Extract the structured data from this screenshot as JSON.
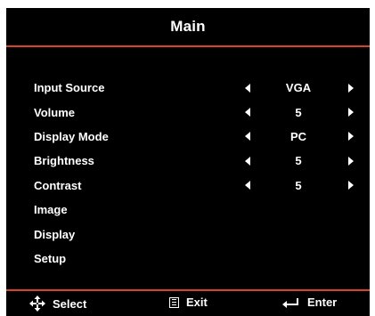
{
  "osd": {
    "title": "Main",
    "accent_color": "#d8432a",
    "background_color": "#000000",
    "items": [
      {
        "label": "Input Source",
        "value": "VGA",
        "adjustable": true
      },
      {
        "label": "Volume",
        "value": "5",
        "adjustable": true
      },
      {
        "label": "Display Mode",
        "value": "PC",
        "adjustable": true
      },
      {
        "label": "Brightness",
        "value": "5",
        "adjustable": true
      },
      {
        "label": "Contrast",
        "value": "5",
        "adjustable": true
      },
      {
        "label": "Image",
        "value": "",
        "adjustable": false
      },
      {
        "label": "Display",
        "value": "",
        "adjustable": false
      },
      {
        "label": "Setup",
        "value": "",
        "adjustable": false
      }
    ]
  },
  "footer": {
    "select_label": "Select",
    "select_icon": "four-way-arrows-icon",
    "exit_label": "Exit",
    "exit_icon": "menu-box-icon",
    "enter_label": "Enter",
    "enter_icon": "return-arrow-icon"
  }
}
